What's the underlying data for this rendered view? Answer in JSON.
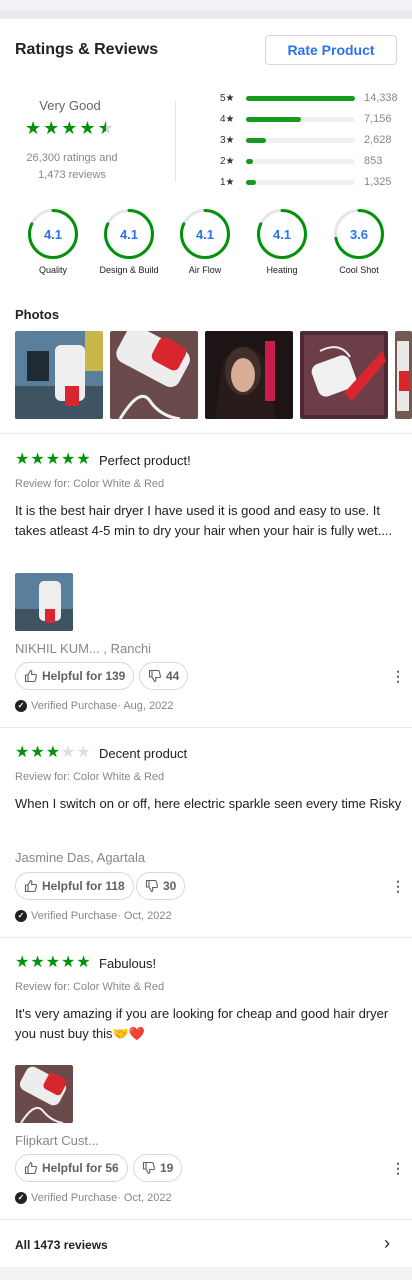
{
  "header": {
    "title": "Ratings & Reviews",
    "rate_button": "Rate Product"
  },
  "overall": {
    "label": "Very Good",
    "stars": 4.4,
    "ratings_line": "26,300 ratings and",
    "reviews_line": "1,473 reviews"
  },
  "distribution": [
    {
      "label": "5★",
      "count": "14,338",
      "fraction": 1.0
    },
    {
      "label": "4★",
      "count": "7,156",
      "fraction": 0.5
    },
    {
      "label": "3★",
      "count": "2,628",
      "fraction": 0.18
    },
    {
      "label": "2★",
      "count": "853",
      "fraction": 0.06
    },
    {
      "label": "1★",
      "count": "1,325",
      "fraction": 0.09
    }
  ],
  "features": [
    {
      "value": "4.1",
      "label": "Quality",
      "fraction": 0.82
    },
    {
      "value": "4.1",
      "label": "Design & Build",
      "fraction": 0.82
    },
    {
      "value": "4.1",
      "label": "Air Flow",
      "fraction": 0.82
    },
    {
      "value": "4.1",
      "label": "Heating",
      "fraction": 0.82
    },
    {
      "value": "3.6",
      "label": "Cool Shot",
      "fraction": 0.72
    }
  ],
  "photos": {
    "title": "Photos"
  },
  "reviews": [
    {
      "stars": 5,
      "title": "Perfect product!",
      "review_for": "Review for: Color White & Red",
      "body": "It is the best hair dryer I have used it is good and easy to use. It takes atleast 4-5 min to dry your hair when your hair is fully wet....",
      "author": "NIKHIL KUM... , Ranchi",
      "helpful": "Helpful for 139",
      "dislikes": "44",
      "verified": "Verified Purchase· Aug, 2022"
    },
    {
      "stars": 3,
      "title": "Decent product",
      "review_for": "Review for: Color White & Red",
      "body": "When I switch on or off, here electric sparkle seen every time Risky",
      "author": "Jasmine Das, Agartala",
      "helpful": "Helpful for 118",
      "dislikes": "30",
      "verified": "Verified Purchase· Oct, 2022"
    },
    {
      "stars": 5,
      "title": "Fabulous!",
      "review_for": "Review for: Color White & Red",
      "body": "It's very amazing if you are looking for cheap and good hair dryer you nust buy this🤝❤️",
      "author": "Flipkart Cust...",
      "helpful": "Helpful for 56",
      "dislikes": "19",
      "verified": "Verified Purchase· Oct, 2022"
    }
  ],
  "footer": {
    "all_reviews": "All 1473 reviews"
  },
  "colors": {
    "green": "#00930a",
    "accent": "#2874f0",
    "grey": "#878787"
  }
}
